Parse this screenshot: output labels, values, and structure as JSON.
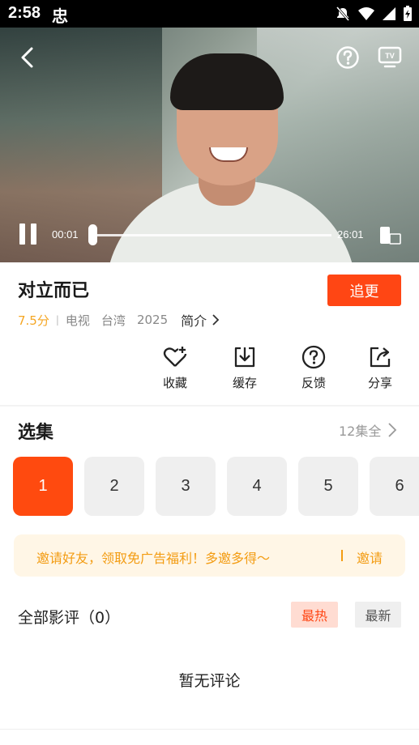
{
  "status_bar": {
    "time": "2:58",
    "app_glyph": "忠"
  },
  "player": {
    "current_time": "00:01",
    "total_time": "26:01",
    "progress_fraction": 0.001
  },
  "show": {
    "title": "对立而已",
    "follow_label": "追更",
    "score": "7.5分",
    "type": "电视",
    "region": "台湾",
    "year": "2025",
    "intro_label": "简介"
  },
  "actions": [
    {
      "label": "收藏",
      "icon": "heart-plus-icon"
    },
    {
      "label": "缓存",
      "icon": "download-icon"
    },
    {
      "label": "反馈",
      "icon": "question-icon"
    },
    {
      "label": "分享",
      "icon": "share-icon"
    }
  ],
  "episodes_section": {
    "title": "选集",
    "count_label": "12集全",
    "items": [
      "1",
      "2",
      "3",
      "4",
      "5",
      "6"
    ],
    "active_index": 0
  },
  "invite": {
    "text": "邀请好友，领取免广告福利！多邀多得～",
    "button": "邀请"
  },
  "comments": {
    "title": "全部影评（0）",
    "sort_hot": "最热",
    "sort_new": "最新",
    "empty_text": "暂无评论"
  },
  "colors": {
    "accent": "#ff4614",
    "score": "#f5a623",
    "invite_text": "#f39c12",
    "invite_bg": "#fff6e6"
  }
}
